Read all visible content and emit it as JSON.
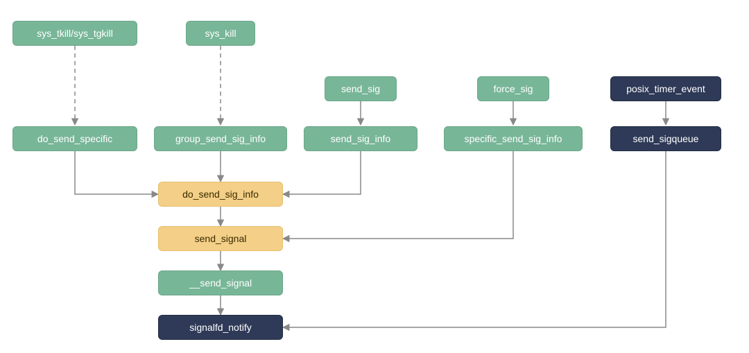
{
  "chart_data": {
    "type": "diagram",
    "title": "",
    "nodes": [
      {
        "id": "sys_tkill",
        "label": "sys_tkill/sys_tgkill",
        "style": "green-light"
      },
      {
        "id": "sys_kill",
        "label": "sys_kill",
        "style": "green-light"
      },
      {
        "id": "send_sig",
        "label": "send_sig",
        "style": "green-light"
      },
      {
        "id": "force_sig",
        "label": "force_sig",
        "style": "green-light"
      },
      {
        "id": "posix_timer_event",
        "label": "posix_timer_event",
        "style": "darkblue"
      },
      {
        "id": "do_send_specific",
        "label": "do_send_specific",
        "style": "green-light"
      },
      {
        "id": "group_send_sig_info",
        "label": "group_send_sig_info",
        "style": "green-light"
      },
      {
        "id": "send_sig_info",
        "label": "send_sig_info",
        "style": "green-light"
      },
      {
        "id": "specific_send",
        "label": "specific_send_sig_info",
        "style": "green-light"
      },
      {
        "id": "send_sigqueue",
        "label": "send_sigqueue",
        "style": "darkblue"
      },
      {
        "id": "do_send_sig_info",
        "label": "do_send_sig_info",
        "style": "yellow"
      },
      {
        "id": "send_signal",
        "label": "send_signal",
        "style": "yellow"
      },
      {
        "id": "__send_signal",
        "label": "__send_signal",
        "style": "green-light"
      },
      {
        "id": "signalfd_notify",
        "label": "signalfd_notify",
        "style": "darkblue"
      }
    ],
    "edges": [
      {
        "from": "sys_tkill",
        "to": "do_send_specific",
        "dashed": true
      },
      {
        "from": "sys_kill",
        "to": "group_send_sig_info",
        "dashed": true
      },
      {
        "from": "send_sig",
        "to": "send_sig_info",
        "dashed": false
      },
      {
        "from": "force_sig",
        "to": "specific_send",
        "dashed": false
      },
      {
        "from": "posix_timer_event",
        "to": "send_sigqueue",
        "dashed": false
      },
      {
        "from": "do_send_specific",
        "to": "do_send_sig_info",
        "dashed": false
      },
      {
        "from": "group_send_sig_info",
        "to": "do_send_sig_info",
        "dashed": false
      },
      {
        "from": "send_sig_info",
        "to": "do_send_sig_info",
        "dashed": false
      },
      {
        "from": "specific_send",
        "to": "send_signal",
        "dashed": false
      },
      {
        "from": "do_send_sig_info",
        "to": "send_signal",
        "dashed": false
      },
      {
        "from": "send_signal",
        "to": "__send_signal",
        "dashed": false
      },
      {
        "from": "__send_signal",
        "to": "signalfd_notify",
        "dashed": false
      },
      {
        "from": "send_sigqueue",
        "to": "signalfd_notify",
        "dashed": false
      }
    ]
  },
  "colors": {
    "green": "#78b698",
    "yellow": "#f3cf87",
    "darkblue": "#2e3a57",
    "arrow": "#888888"
  }
}
